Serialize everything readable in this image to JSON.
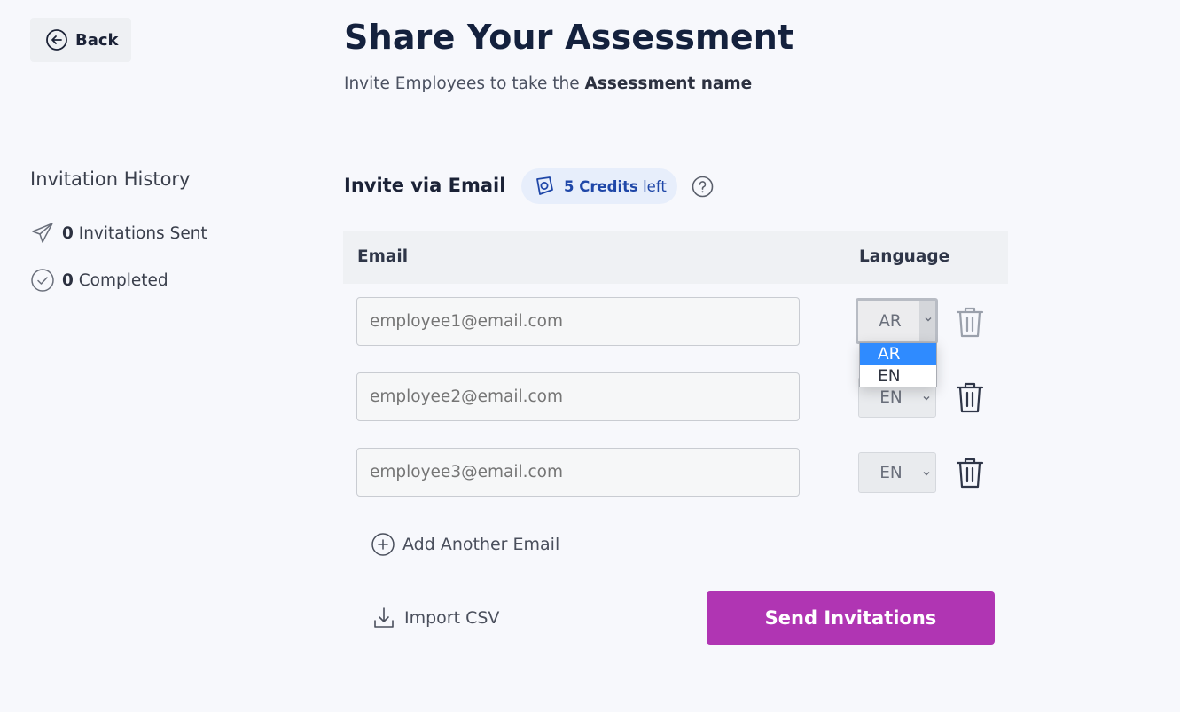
{
  "header": {
    "back_label": "Back",
    "title": "Share Your Assessment",
    "subtitle_prefix": "Invite Employees to take the ",
    "subtitle_bold": "Assessment name"
  },
  "history": {
    "title": "Invitation History",
    "sent_count": "0",
    "sent_label": " Invitations Sent",
    "completed_count": "0",
    "completed_label": " Completed"
  },
  "invite": {
    "title": "Invite via Email",
    "credits_count": "5 Credits",
    "credits_suffix": " left"
  },
  "table": {
    "email_header": "Email",
    "language_header": "Language",
    "rows": [
      {
        "email_placeholder": "employee1@email.com",
        "language": "AR"
      },
      {
        "email_placeholder": "employee2@email.com",
        "language": "EN"
      },
      {
        "email_placeholder": "employee3@email.com",
        "language": "EN"
      }
    ]
  },
  "dropdown": {
    "options": [
      "AR",
      "EN"
    ],
    "selected": "AR"
  },
  "actions": {
    "add_email": "Add Another Email",
    "import_csv": "Import CSV",
    "send": "Send Invitations"
  },
  "colors": {
    "accent": "#b035b3",
    "credits_bg": "#e7eefb",
    "credits_text": "#1f47a8",
    "dropdown_selected": "#2f8bff"
  }
}
